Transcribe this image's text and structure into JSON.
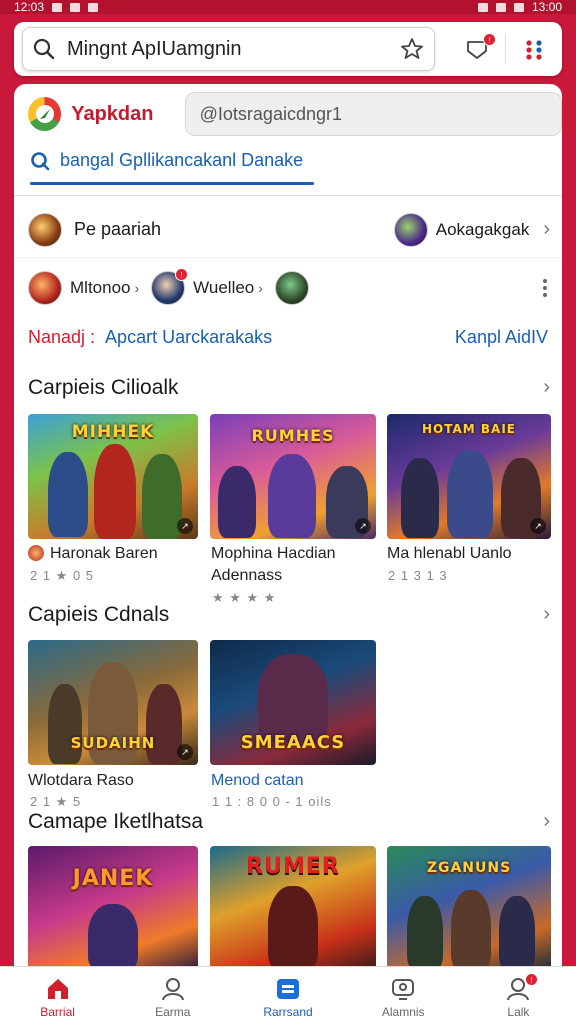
{
  "status_bar": {
    "time_left": "12:03",
    "time_right": "13:00"
  },
  "search": {
    "query": "Mingnt ApIUamgnin"
  },
  "brand": {
    "name": "Yapkdan",
    "field_text": "@Iotsragaicdngr1"
  },
  "tab": {
    "label": "bangal Gpllikancakanl Danake"
  },
  "account": {
    "name": "Pe paariah",
    "secondary_name": "Aokagakgak"
  },
  "quick": {
    "item1": "Mltonoo",
    "item2": "Wuelleo"
  },
  "links": {
    "red": "Nanadj :",
    "blue": "Apcart Uarckarakaks",
    "right": "Kanpl AidIV"
  },
  "sections": [
    {
      "title": "Carpieis Cilioalk",
      "apps": [
        {
          "name": "Haronak Baren",
          "meta": "2 1 ★ 0 5",
          "logo": "MIHHEK"
        },
        {
          "name": "Mophina Hacdian Adennass",
          "meta": "★ ★ ★ ★",
          "logo": "RUMHES"
        },
        {
          "name": "Ma hlenabl Uanlo",
          "meta": "2 1 3 1 3",
          "logo": "HOTAM BAIE"
        }
      ]
    },
    {
      "title": "Capieis Cdnals",
      "apps": [
        {
          "name": "Wlotdara Raso",
          "meta": "2 1 ★ 5",
          "logo": "SUDAIHN"
        },
        {
          "name": "Menod catan",
          "meta": "1 1 : 8 0 0 - 1 oils",
          "logo": "SMEAACS"
        }
      ]
    },
    {
      "title": "Camape Iketlhatsa",
      "apps": [
        {
          "name": "",
          "meta": "",
          "logo": "JANEK"
        },
        {
          "name": "",
          "meta": "",
          "logo": "RUMER"
        },
        {
          "name": "",
          "meta": "",
          "logo": "ZGANUNS"
        }
      ]
    }
  ],
  "nav": [
    {
      "label": "Barrial",
      "icon": "home-icon"
    },
    {
      "label": "Earma",
      "icon": "person-icon"
    },
    {
      "label": "Rarrsand",
      "icon": "apps-icon"
    },
    {
      "label": "Alamnis",
      "icon": "support-icon"
    },
    {
      "label": "Lalk",
      "icon": "account-icon"
    }
  ],
  "colors": {
    "brand_red": "#c8193a",
    "link_blue": "#1a5fb4"
  }
}
